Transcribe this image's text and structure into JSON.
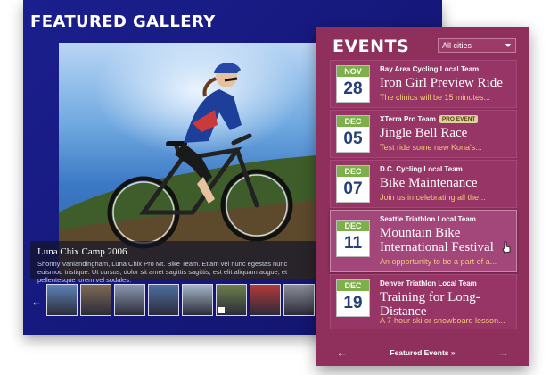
{
  "gallery": {
    "title": "FEATURED GALLERY",
    "caption_title": "Luna Chix Camp 2006",
    "caption_text": "Shonny Vanlandingham, Luna Chix Pro Mt. Bike Team. Etiam vel nunc egestas nunc euismod tristique. Ut cursus, dolor sit amet sagittis sagittis, est elit aliquam augue, et pellentesque lorem vel sodales.",
    "prev_arrow": "←",
    "thumbnails": [
      "#5e83b9",
      "#7d6a55",
      "#8b98b0",
      "#4f6fa2",
      "#a5b8c8",
      "#6c7f4c",
      "#b33a3a",
      "#8a8f99",
      "#6d7583"
    ]
  },
  "events": {
    "title": "EVENTS",
    "city_filter": "All cities",
    "items": [
      {
        "month": "NOV",
        "day": "28",
        "org": "Bay Area Cycling Local Team",
        "badge": "",
        "title": "Iron Girl Preview Ride",
        "desc": "The clinics will be 15 minutes..."
      },
      {
        "month": "DEC",
        "day": "05",
        "org": "XTerra Pro Team",
        "badge": "PRO EVENT",
        "title": "Jingle Bell Race",
        "desc": "Test ride some new Kona's..."
      },
      {
        "month": "DEC",
        "day": "07",
        "org": "D.C. Cycling Local Team",
        "badge": "",
        "title": "Bike Maintenance",
        "desc": "Join us in celebrating all the..."
      },
      {
        "month": "DEC",
        "day": "11",
        "org": "Seattle Triathlon Local Team",
        "badge": "",
        "title": "Mountain Bike International Festival",
        "desc": "An opportunity to be a part of a..."
      },
      {
        "month": "DEC",
        "day": "19",
        "org": "Denver Triathlon Local Team",
        "badge": "",
        "title": "Training for Long-Distance",
        "desc": "A 7-hour ski or snowboard lesson..."
      }
    ],
    "footer": {
      "prev": "←",
      "label": "Featured Events »",
      "next": "→"
    }
  },
  "colors": {
    "accent_green": "#7db04a",
    "panel_magenta": "#8f2f5c",
    "gallery_blue": "#1b1f8e",
    "desc_gold": "#f1c87a"
  }
}
